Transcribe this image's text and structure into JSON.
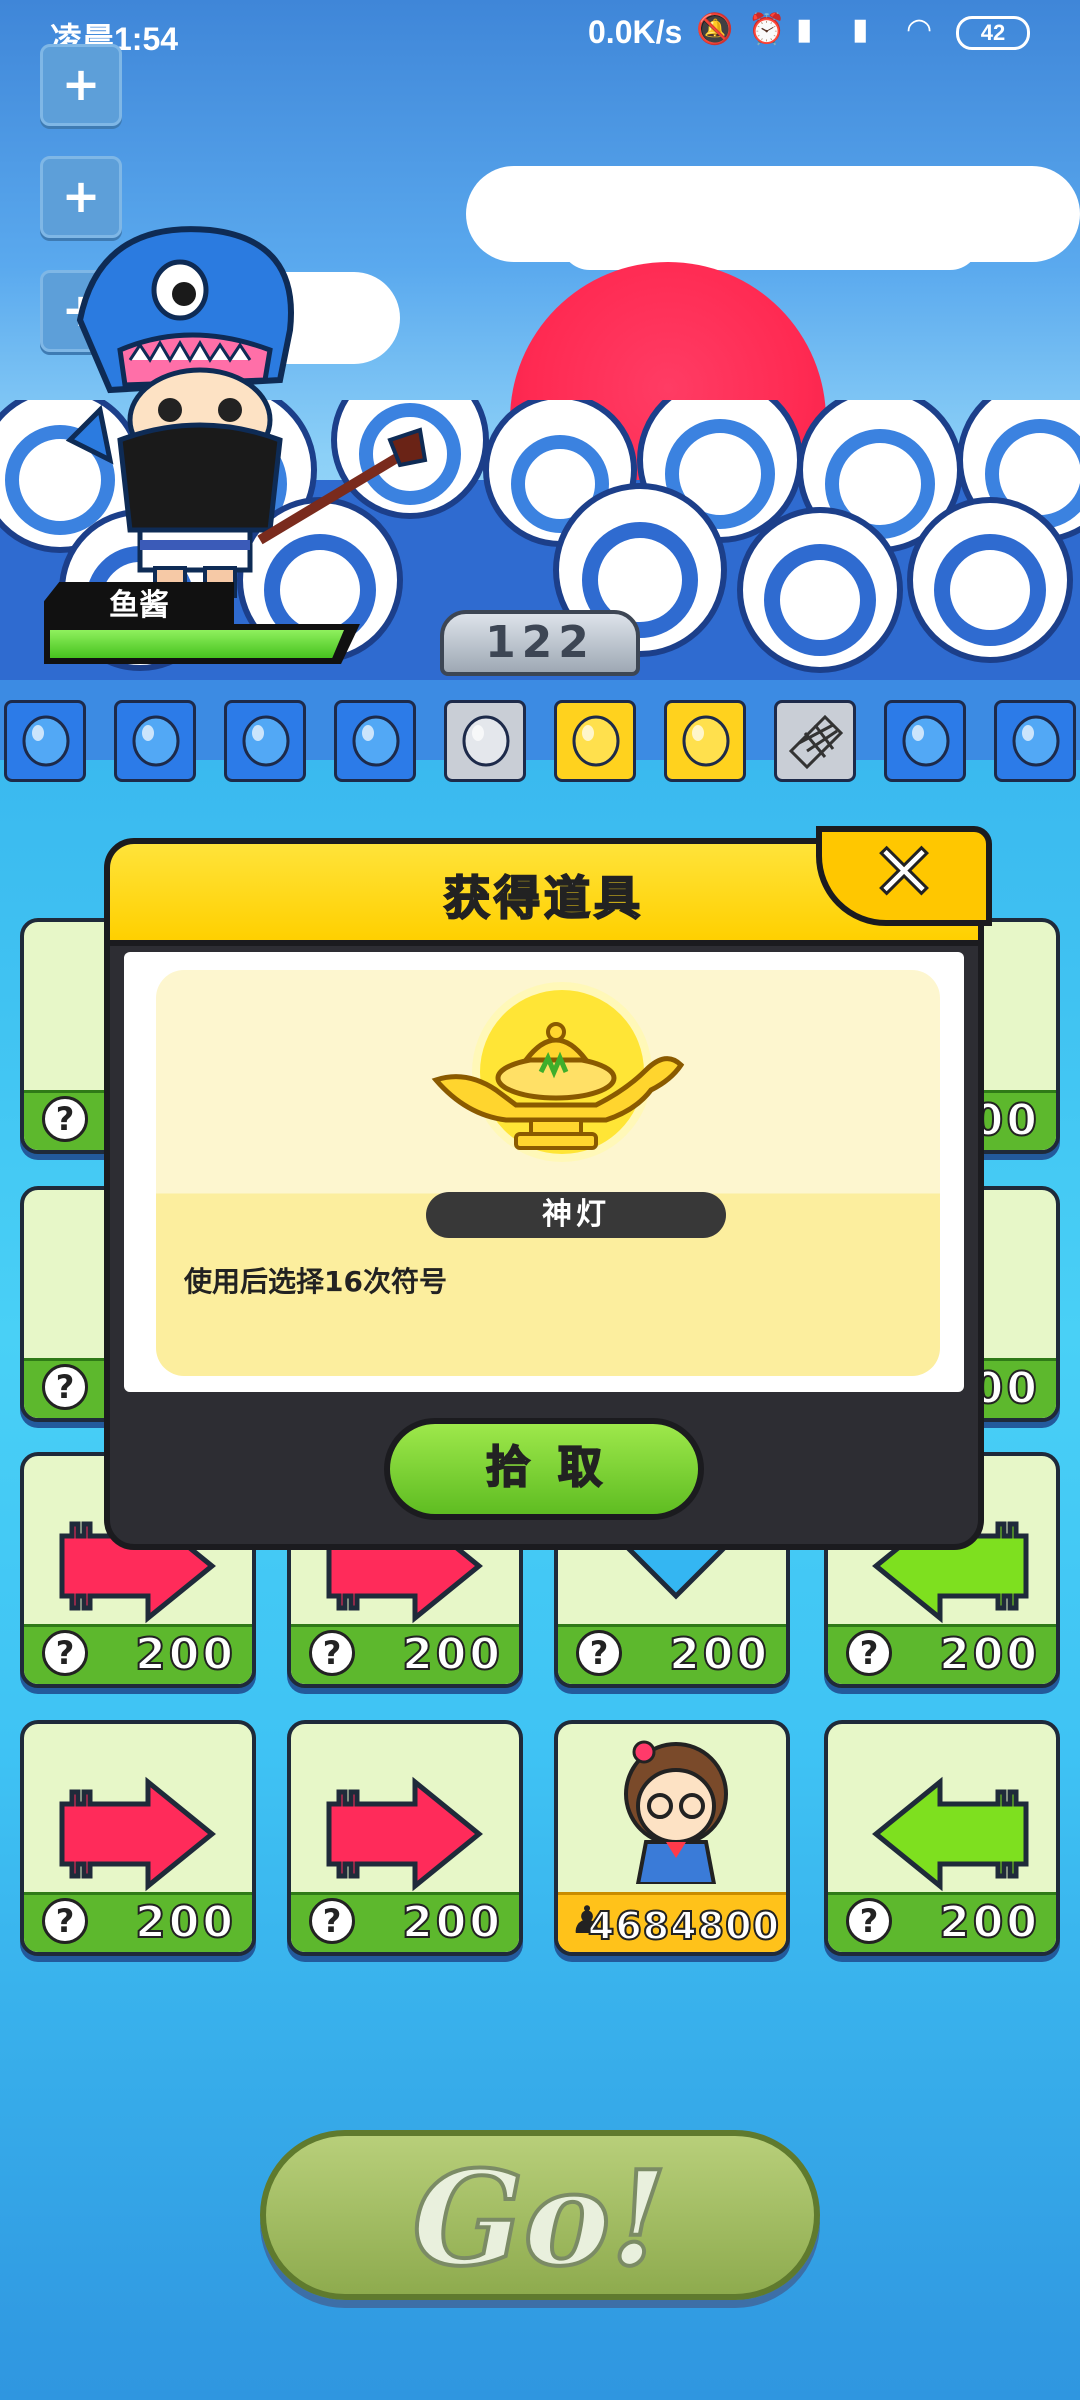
{
  "status_bar": {
    "time": "凌晨1:54",
    "net_speed": "0.0K/s",
    "battery": "42",
    "icons": [
      "mute-icon",
      "alarm-icon",
      "hd-signal-icon",
      "signal-icon",
      "wifi-icon",
      "battery-icon"
    ]
  },
  "side_buttons": [
    "plus-icon",
    "plus-icon",
    "plus-icon"
  ],
  "player": {
    "name": "鱼酱",
    "hp_fraction": 0.98
  },
  "counter": "122",
  "item_row": [
    {
      "color": "blue",
      "icon": "balloon-icon"
    },
    {
      "color": "blue",
      "icon": "balloon-icon"
    },
    {
      "color": "blue",
      "icon": "balloon-icon"
    },
    {
      "color": "blue",
      "icon": "balloon-icon"
    },
    {
      "color": "gray",
      "icon": "balloon-icon"
    },
    {
      "color": "yellow",
      "icon": "balloon-icon"
    },
    {
      "color": "yellow",
      "icon": "balloon-icon"
    },
    {
      "color": "gray",
      "icon": "net-icon"
    },
    {
      "color": "blue",
      "icon": "balloon-icon"
    },
    {
      "color": "blue",
      "icon": "balloon-icon"
    }
  ],
  "cards": {
    "row3": [
      {
        "arrow": "right-arrow-icon",
        "color": "#ff2b5a",
        "price": "200"
      },
      {
        "arrow": "right-arrow-icon",
        "color": "#ff2b5a",
        "price": "200"
      },
      {
        "arrow": "down-arrow-icon",
        "color": "#34b6f2",
        "price": "200"
      },
      {
        "arrow": "left-arrow-icon",
        "color": "#7ee01f",
        "price": "200"
      }
    ],
    "row4": [
      {
        "arrow": "right-arrow-icon",
        "color": "#ff2b5a",
        "price": "200"
      },
      {
        "arrow": "right-arrow-icon",
        "color": "#ff2b5a",
        "price": "200"
      },
      {
        "special": "avatar-icon",
        "price": "4684800"
      },
      {
        "arrow": "left-arrow-icon",
        "color": "#7ee01f",
        "price": "200"
      }
    ],
    "side_prices": [
      "00",
      "00"
    ]
  },
  "modal": {
    "title": "获得道具",
    "close_label": "✕",
    "item_icon": "magic-lamp-icon",
    "item_name": "神灯",
    "item_description": "使用后选择16次符号",
    "pick_button": "拾取"
  },
  "go_button": "Go!",
  "colors": {
    "modal_header": "#ffd000",
    "pick_button": "#5fbd22",
    "card_bottom": "#5db82d",
    "special_bottom": "#ffc21a"
  }
}
